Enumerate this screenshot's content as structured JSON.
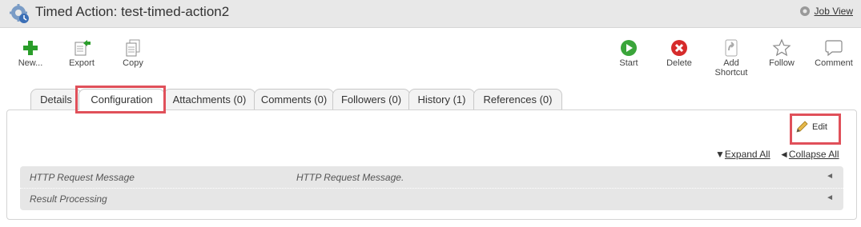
{
  "header": {
    "title": "Timed Action: test-timed-action2",
    "job_view": "Job View"
  },
  "toolbar": {
    "new": "New...",
    "export": "Export",
    "copy": "Copy",
    "start": "Start",
    "delete": "Delete",
    "add_shortcut_1": "Add",
    "add_shortcut_2": "Shortcut",
    "follow": "Follow",
    "comment": "Comment"
  },
  "tabs": [
    "Details",
    "Configuration",
    "Attachments (0)",
    "Comments (0)",
    "Followers (0)",
    "History (1)",
    "References (0)"
  ],
  "content": {
    "edit": "Edit",
    "expand_all": "Expand All",
    "collapse_all": "Collapse All",
    "rows": [
      {
        "name": "HTTP Request Message",
        "value": "HTTP Request Message."
      },
      {
        "name": "Result Processing",
        "value": ""
      }
    ]
  },
  "colors": {
    "highlight": "#e0505a",
    "add_green": "#2a9d2a",
    "start_green": "#3aa53a",
    "delete_red": "#d62b2b"
  }
}
